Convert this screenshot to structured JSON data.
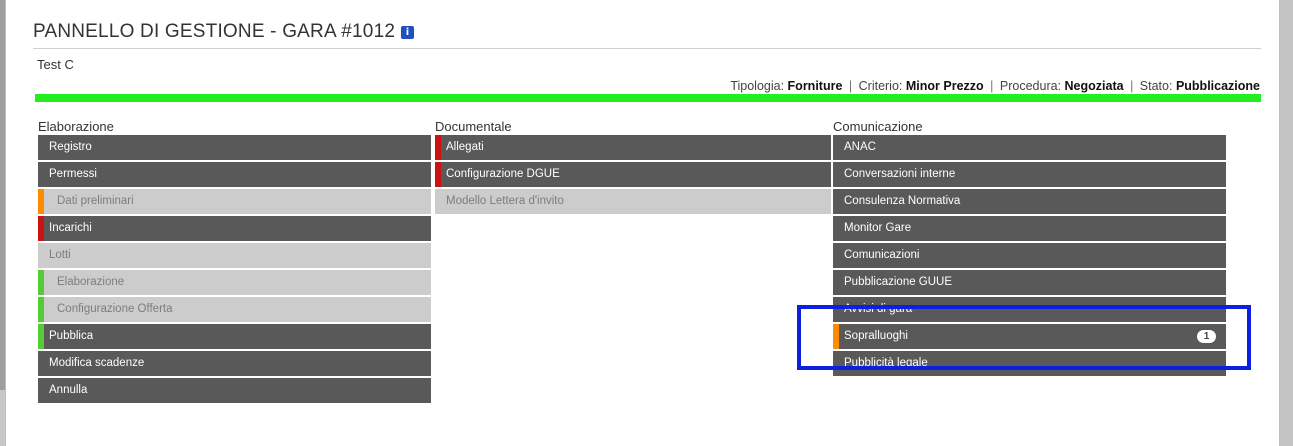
{
  "header": {
    "title": "PANNELLO DI GESTIONE - GARA #1012",
    "info_icon": "i",
    "subtitle": "Test C"
  },
  "meta": {
    "tipologia_label": "Tipologia:",
    "tipologia_value": "Forniture",
    "criterio_label": "Criterio:",
    "criterio_value": "Minor Prezzo",
    "procedura_label": "Procedura:",
    "procedura_value": "Negoziata",
    "stato_label": "Stato:",
    "stato_value": "Pubblicazione",
    "separator": "|"
  },
  "progress": {
    "percent": 100,
    "color": "#22ee22"
  },
  "colors": {
    "dark_item": "#595959",
    "light_item": "#cccccc",
    "marker_orange": "#ff8c00",
    "marker_red": "#cc1111",
    "marker_green": "#55cc33",
    "highlight": "#0b20e0"
  },
  "columns": {
    "elaborazione": {
      "title": "Elaborazione",
      "items": [
        {
          "label": "Registro",
          "style": "dark"
        },
        {
          "label": "Permessi",
          "style": "dark"
        },
        {
          "label": "Dati preliminari",
          "style": "light",
          "marker": "orange"
        },
        {
          "label": "Incarichi",
          "style": "dark",
          "marker": "red"
        },
        {
          "label": "Lotti",
          "style": "light"
        },
        {
          "label": "Elaborazione",
          "style": "light",
          "marker": "green"
        },
        {
          "label": "Configurazione Offerta",
          "style": "light",
          "marker": "green"
        },
        {
          "label": "Pubblica",
          "style": "dark",
          "marker": "green"
        },
        {
          "label": "Modifica scadenze",
          "style": "dark"
        },
        {
          "label": "Annulla",
          "style": "dark"
        }
      ]
    },
    "documentale": {
      "title": "Documentale",
      "items": [
        {
          "label": "Allegati",
          "style": "dark",
          "marker": "red"
        },
        {
          "label": "Configurazione DGUE",
          "style": "dark",
          "marker": "red"
        },
        {
          "label": "Modello Lettera d'invito",
          "style": "light"
        }
      ]
    },
    "comunicazione": {
      "title": "Comunicazione",
      "items": [
        {
          "label": "ANAC",
          "style": "dark"
        },
        {
          "label": "Conversazioni interne",
          "style": "dark"
        },
        {
          "label": "Consulenza Normativa",
          "style": "dark"
        },
        {
          "label": "Monitor Gare",
          "style": "dark"
        },
        {
          "label": "Comunicazioni",
          "style": "dark"
        },
        {
          "label": "Pubblicazione GUUE",
          "style": "dark"
        },
        {
          "label": "Avvisi di gara",
          "style": "dark"
        },
        {
          "label": "Sopralluoghi",
          "style": "dark",
          "marker": "orange",
          "badge": "1"
        },
        {
          "label": "Pubblicità legale",
          "style": "dark"
        }
      ]
    }
  }
}
